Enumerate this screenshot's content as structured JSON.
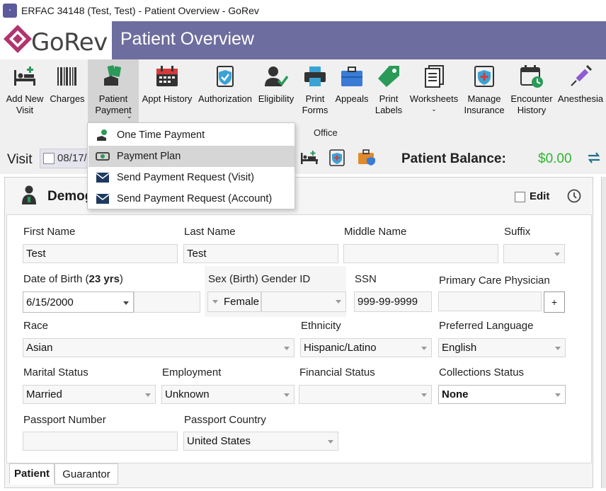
{
  "window": {
    "title": "ERFAC 34148 (Test, Test) - Patient Overview - GoRev"
  },
  "header": {
    "logo_text": "GoRev",
    "title": "Patient Overview"
  },
  "toolbar": {
    "add_new_visit": "Add New\nVisit",
    "charges": "Charges",
    "patient_payment": "Patient\nPayment",
    "appt_history": "Appt History",
    "authorization": "Authorization",
    "eligibility": "Eligibility",
    "print_forms": "Print\nForms",
    "appeals": "Appeals",
    "print_labels": "Print\nLabels",
    "worksheets": "Worksheets",
    "manage_insurance": "Manage\nInsurance",
    "encounter_history": "Encounter\nHistory",
    "anesthesia": "Anesthesia",
    "group_label": "Office"
  },
  "payment_menu": {
    "items": [
      {
        "label": "One Time Payment"
      },
      {
        "label": "Payment Plan"
      },
      {
        "label": "Send Payment Request (Visit)"
      },
      {
        "label": "Send Payment Request (Account)"
      }
    ]
  },
  "visit": {
    "label": "Visit",
    "date": "08/17/"
  },
  "balance": {
    "label": "Patient Balance:",
    "value": "$0.00",
    "color": "#2fb52f"
  },
  "demographics": {
    "title": "Demog",
    "edit_label": "Edit",
    "first_name": {
      "label": "First Name",
      "value": "Test"
    },
    "last_name": {
      "label": "Last Name",
      "value": "Test"
    },
    "middle_name": {
      "label": "Middle Name",
      "value": ""
    },
    "suffix": {
      "label": "Suffix",
      "value": ""
    },
    "dob": {
      "label_prefix": "Date of Birth (",
      "label_age": "23 yrs",
      "label_suffix": ")",
      "value": "6/15/2000"
    },
    "sex": {
      "label": "Sex (Birth) Gender ID",
      "value": "Female"
    },
    "ssn": {
      "label": "SSN",
      "value": "999-99-9999"
    },
    "pcp": {
      "label": "Primary Care Physician",
      "value": "",
      "add_label": "+"
    },
    "race": {
      "label": "Race",
      "value": "Asian"
    },
    "ethnicity": {
      "label": "Ethnicity",
      "value": "Hispanic/Latino"
    },
    "language": {
      "label": "Preferred Language",
      "value": "English"
    },
    "marital": {
      "label": "Marital Status",
      "value": "Married"
    },
    "employment": {
      "label": "Employment",
      "value": "Unknown"
    },
    "financial": {
      "label": "Financial Status",
      "value": ""
    },
    "collections": {
      "label": "Collections Status",
      "value": "None"
    },
    "passport_number": {
      "label": "Passport Number",
      "value": ""
    },
    "passport_country": {
      "label": "Passport Country",
      "value": "United States"
    }
  },
  "tabs": [
    {
      "label": "Patient"
    },
    {
      "label": "Guarantor"
    }
  ],
  "colors": {
    "brand": "#6e6d9f",
    "logo": "#b0356e",
    "accent_green": "#2a9a58"
  }
}
